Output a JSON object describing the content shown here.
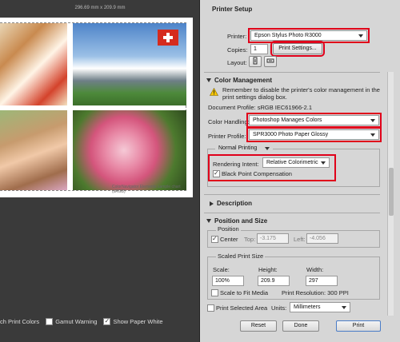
{
  "preview": {
    "dimensions": "296.69 mm x 209.9 mm",
    "chart_credit": "ColorNavigator Elements sample chart (sRGB)",
    "options": [
      {
        "label": "ch Print Colors",
        "checked": false
      },
      {
        "label": "Gamut Warning",
        "checked": false
      },
      {
        "label": "Show Paper White",
        "checked": true
      }
    ]
  },
  "printer_setup": {
    "title": "Printer Setup",
    "printer_label": "Printer:",
    "printer_value": "Epson Stylus Photo R3000",
    "copies_label": "Copies:",
    "copies_value": "1",
    "print_settings_button": "Print Settings...",
    "layout_label": "Layout:"
  },
  "color_management": {
    "title": "Color Management",
    "warning": "Remember to disable the printer's color management in the print settings dialog box.",
    "document_profile": "Document Profile: sRGB IEC61966-2.1",
    "color_handling_label": "Color Handling:",
    "color_handling_value": "Photoshop Manages Colors",
    "printer_profile_label": "Printer Profile:",
    "printer_profile_value": "SPR3000 Photo Paper Glossy",
    "printing_mode": "Normal Printing",
    "rendering_intent_label": "Rendering Intent:",
    "rendering_intent_value": "Relative Colorimetric",
    "bpc_label": "Black Point Compensation",
    "bpc_checked": true
  },
  "description": {
    "title": "Description"
  },
  "position_size": {
    "title": "Position and Size",
    "position_group": "Position",
    "center_label": "Center",
    "top_label": "Top:",
    "top_value": "-3.175",
    "left_label": "Left:",
    "left_value": "-4.056",
    "scaled_group": "Scaled Print Size",
    "scale_label": "Scale:",
    "scale_value": "100%",
    "height_label": "Height:",
    "height_value": "209.9",
    "width_label": "Width:",
    "width_value": "297",
    "scale_to_fit_label": "Scale to Fit Media",
    "print_resolution": "Print Resolution: 300 PPI",
    "print_selected_label": "Print Selected Area",
    "units_label": "Units:",
    "units_value": "Millimeters"
  },
  "footer": {
    "reset": "Reset",
    "done": "Done",
    "print": "Print"
  }
}
